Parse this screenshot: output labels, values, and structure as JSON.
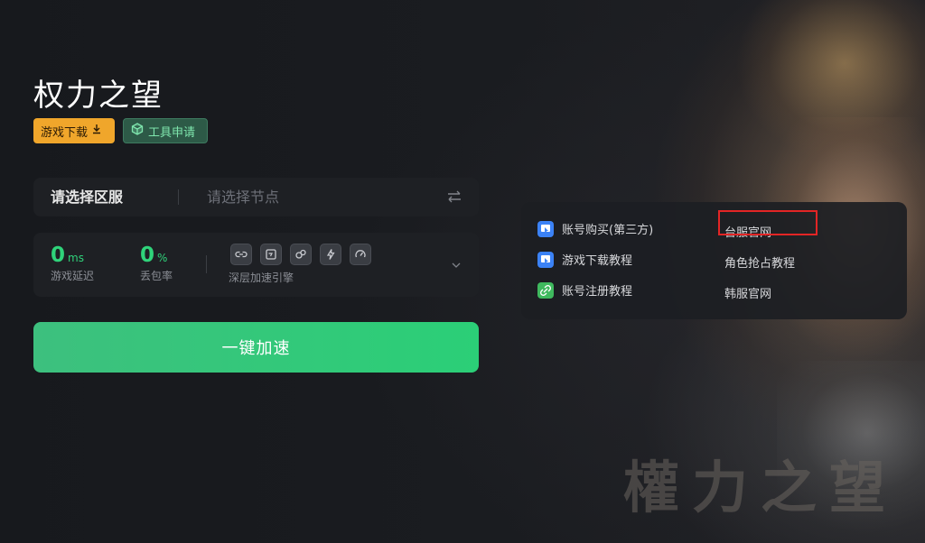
{
  "game": {
    "title": "权力之望",
    "watermark": "權力之望"
  },
  "tags": {
    "download_label": "游戏下载",
    "tools_label": "工具申请"
  },
  "selector": {
    "region_label": "请选择区服",
    "node_placeholder": "请选择节点"
  },
  "stats": {
    "latency_value": "0",
    "latency_unit": "ms",
    "latency_label": "游戏延迟",
    "packet_loss_value": "0",
    "packet_loss_unit": "%",
    "packet_loss_label": "丢包率",
    "engine_label": "深层加速引擎",
    "engine_icons": [
      "link-icon",
      "screen-icon",
      "network-icon",
      "lightning-icon",
      "speed-icon"
    ]
  },
  "accelerate_button": "一键加速",
  "links": {
    "account_purchase": "账号购买(第三方)",
    "game_download_tutorial": "游戏下载教程",
    "account_register_tutorial": "账号注册教程",
    "tw_official": "台服官网",
    "character_reserve_tutorial": "角色抢占教程",
    "kr_official": "韩服官网"
  },
  "colors": {
    "accent_green": "#2fd37a",
    "download_orange": "#f0a62b",
    "highlight_red": "#e32525"
  }
}
